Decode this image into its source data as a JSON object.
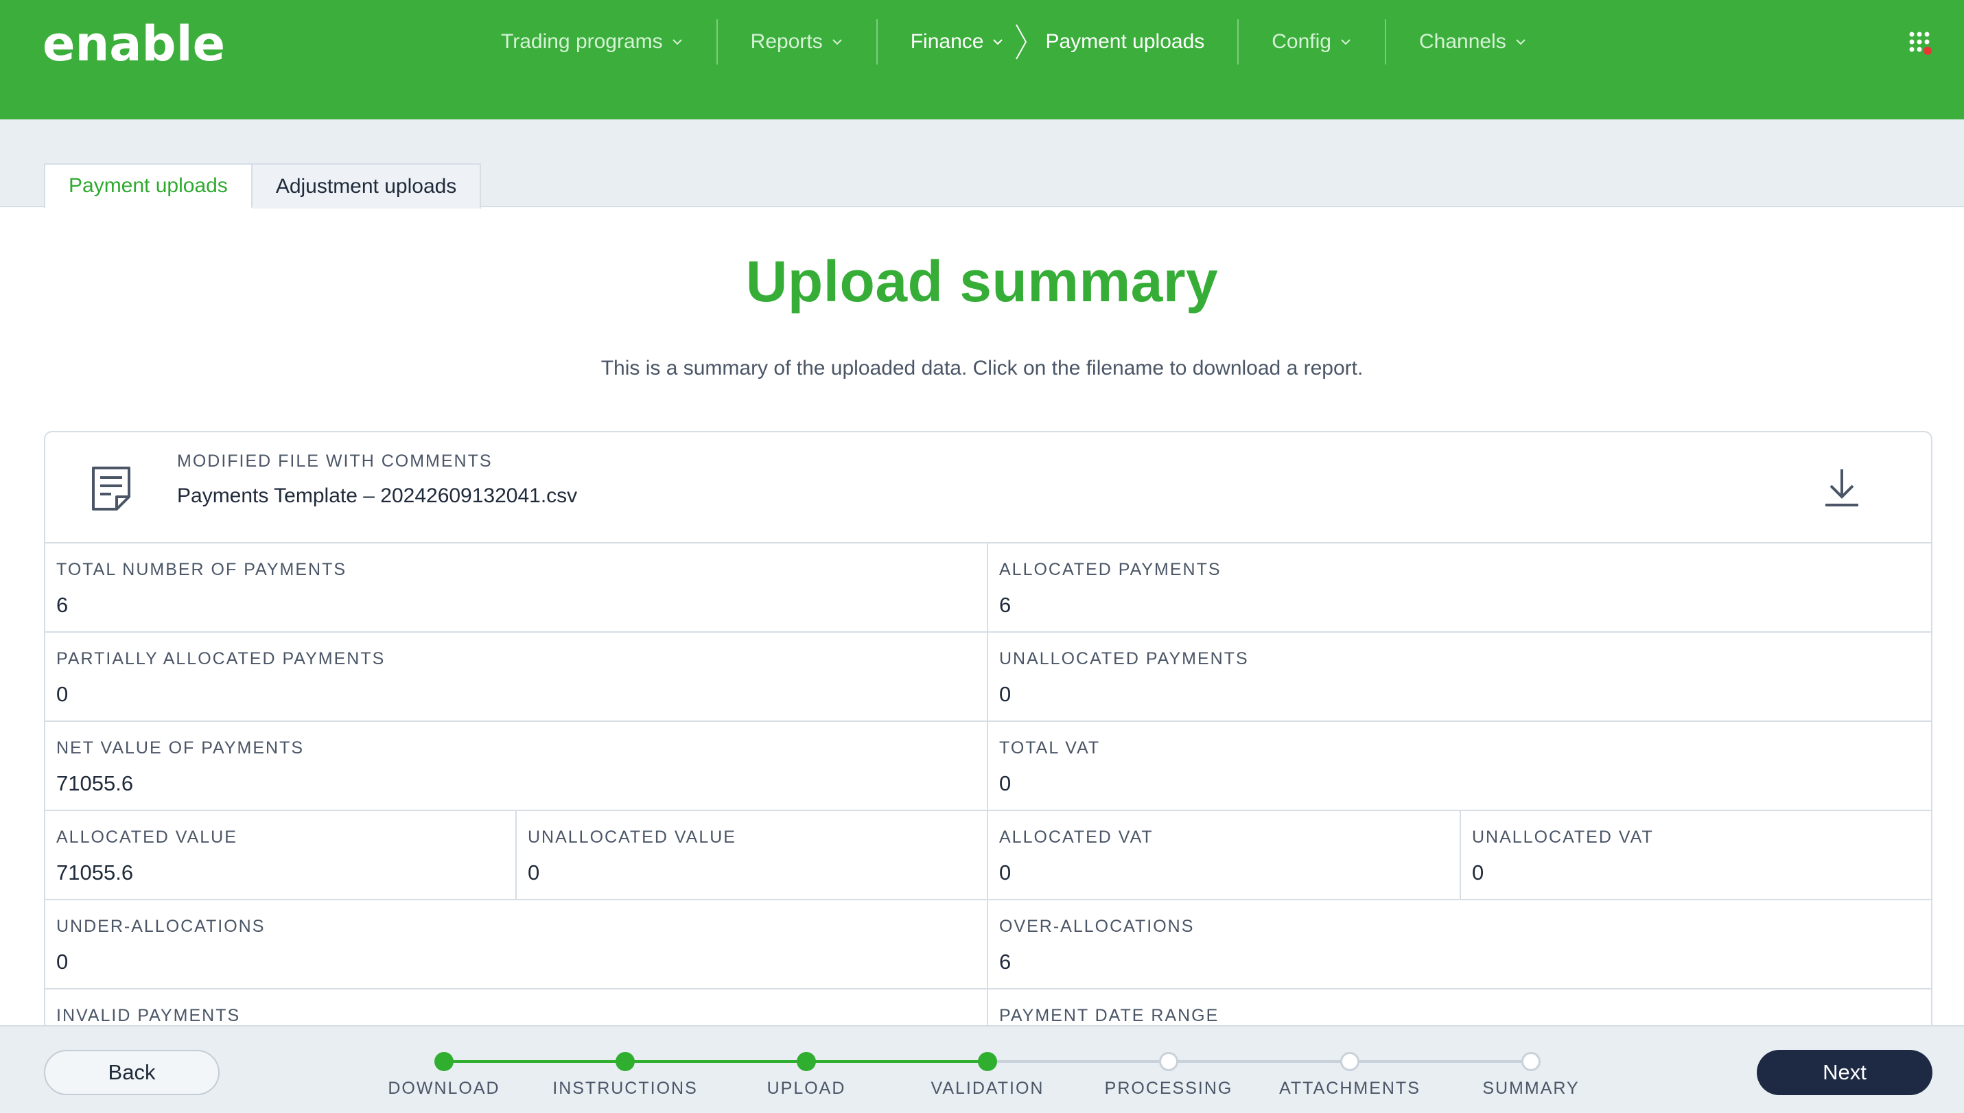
{
  "app": {
    "logo_text": "enable",
    "brand_color": "#3cae3c",
    "accent_color": "#2eaa2e",
    "dark_button_color": "#1e2a44"
  },
  "nav": {
    "items": [
      {
        "label": "Trading programs",
        "has_dropdown": true
      },
      {
        "label": "Reports",
        "has_dropdown": true
      },
      {
        "label": "Finance",
        "has_dropdown": true,
        "active": true
      },
      {
        "label": "Payment uploads",
        "sub_of_active": true
      },
      {
        "label": "Config",
        "has_dropdown": true
      },
      {
        "label": "Channels",
        "has_dropdown": true
      }
    ],
    "apps_icon": "grid-apps-icon",
    "notification_dot_color": "#e53935"
  },
  "tabs": [
    {
      "label": "Payment uploads",
      "active": true
    },
    {
      "label": "Adjustment uploads",
      "active": false
    }
  ],
  "main": {
    "title": "Upload summary",
    "subtitle": "This is a summary of the uploaded data. Click on the filename to download a report.",
    "file": {
      "label": "MODIFIED FILE WITH COMMENTS",
      "name": "Payments Template – 20242609132041.csv",
      "icon": "document-icon",
      "download_icon": "download-icon"
    },
    "stats": {
      "total_number_of_payments": {
        "label": "TOTAL NUMBER OF PAYMENTS",
        "value": "6"
      },
      "allocated_payments": {
        "label": "ALLOCATED PAYMENTS",
        "value": "6"
      },
      "partially_allocated_payments": {
        "label": "PARTIALLY ALLOCATED PAYMENTS",
        "value": "0"
      },
      "unallocated_payments": {
        "label": "UNALLOCATED PAYMENTS",
        "value": "0"
      },
      "net_value_of_payments": {
        "label": "NET VALUE OF PAYMENTS",
        "value": "71055.6"
      },
      "total_vat": {
        "label": "TOTAL VAT",
        "value": "0"
      },
      "allocated_value": {
        "label": "ALLOCATED VALUE",
        "value": "71055.6"
      },
      "unallocated_value": {
        "label": "UNALLOCATED VALUE",
        "value": "0"
      },
      "allocated_vat": {
        "label": "ALLOCATED VAT",
        "value": "0"
      },
      "unallocated_vat": {
        "label": "UNALLOCATED VAT",
        "value": "0"
      },
      "under_allocations": {
        "label": "UNDER-ALLOCATIONS",
        "value": "0"
      },
      "over_allocations": {
        "label": "OVER-ALLOCATIONS",
        "value": "6"
      },
      "invalid_payments": {
        "label": "INVALID PAYMENTS",
        "value": ""
      },
      "payment_date_range": {
        "label": "PAYMENT DATE RANGE",
        "value": ""
      }
    }
  },
  "footer": {
    "back_label": "Back",
    "next_label": "Next",
    "steps": [
      {
        "label": "DOWNLOAD",
        "done": true
      },
      {
        "label": "INSTRUCTIONS",
        "done": true
      },
      {
        "label": "UPLOAD",
        "done": true
      },
      {
        "label": "VALIDATION",
        "done": true
      },
      {
        "label": "PROCESSING",
        "done": false
      },
      {
        "label": "ATTACHMENTS",
        "done": false
      },
      {
        "label": "SUMMARY",
        "done": false
      }
    ]
  }
}
